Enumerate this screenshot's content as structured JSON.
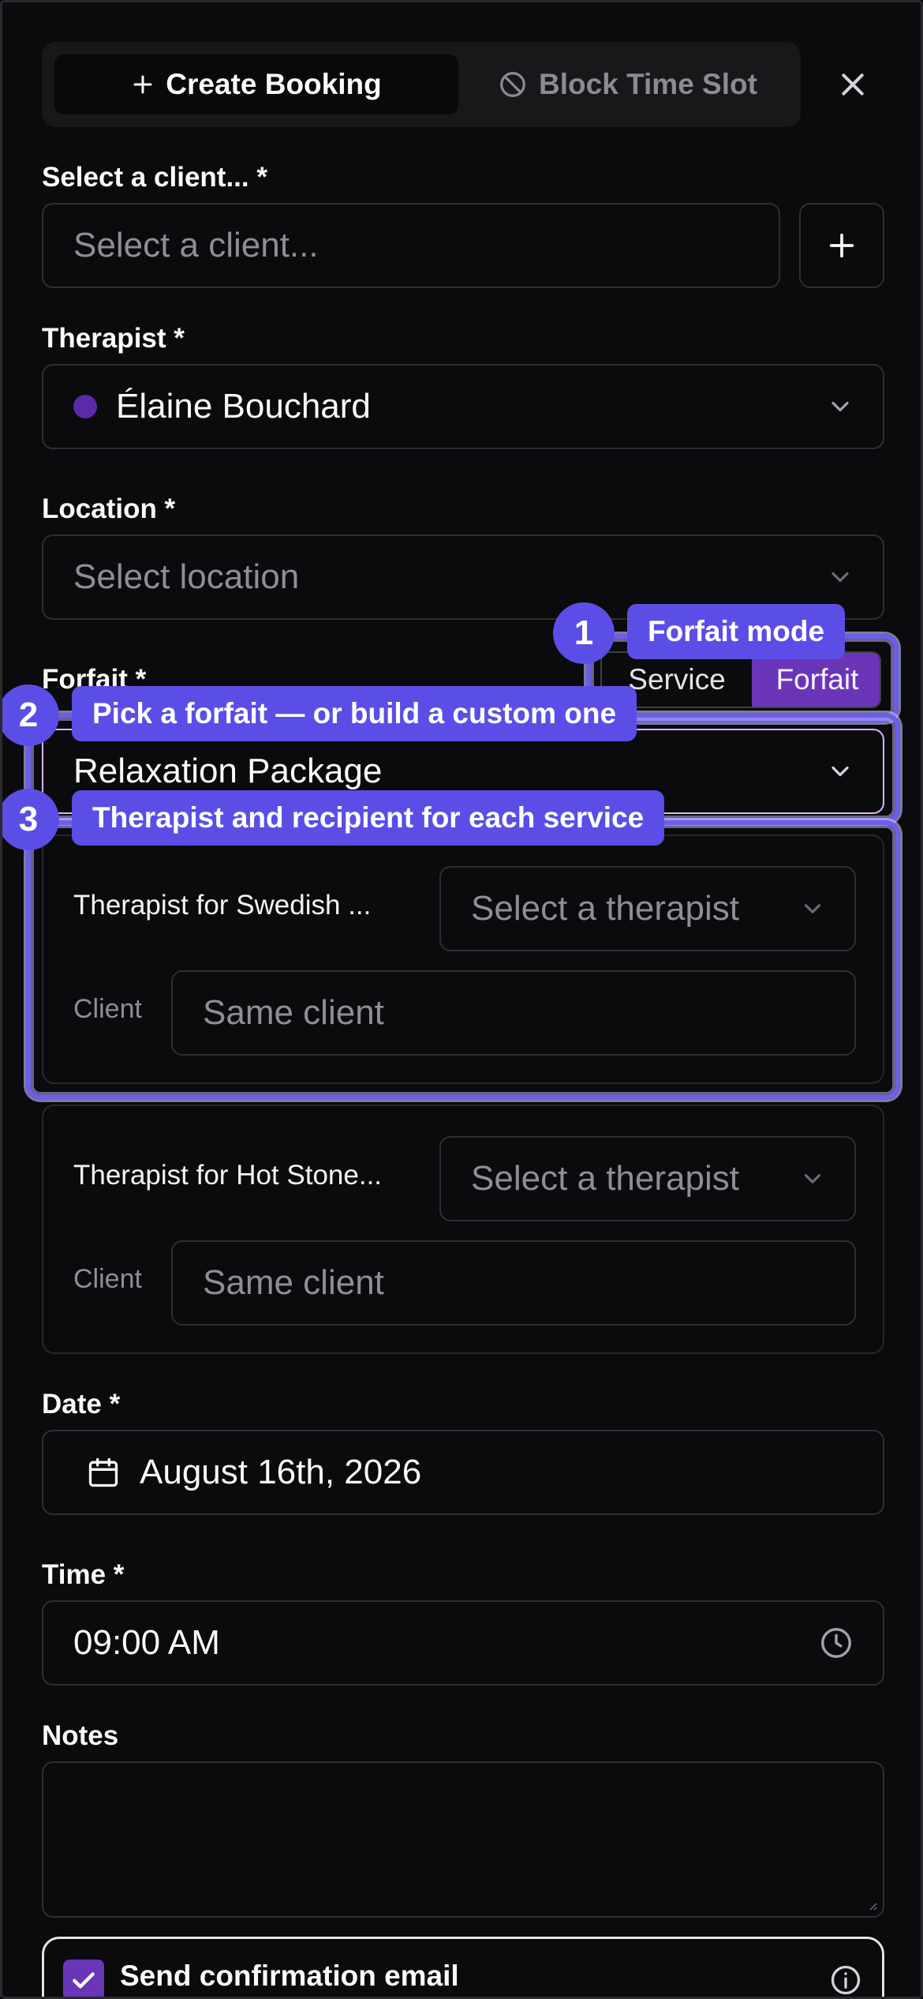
{
  "tabs": {
    "create_booking": "Create Booking",
    "block_time_slot": "Block Time Slot"
  },
  "client": {
    "label": "Select a client... *",
    "placeholder": "Select a client..."
  },
  "therapist": {
    "label": "Therapist *",
    "value": "Élaine Bouchard",
    "dot_color": "#5b2aa8"
  },
  "location": {
    "label": "Location *",
    "placeholder": "Select location"
  },
  "forfait": {
    "label": "Forfait *",
    "mode_options": [
      "Service",
      "Forfait"
    ],
    "mode_selected": "Forfait",
    "value": "Relaxation Package"
  },
  "services": [
    {
      "therapist_label": "Therapist for Swedish ...",
      "therapist_placeholder": "Select a therapist",
      "client_label": "Client",
      "client_placeholder": "Same client"
    },
    {
      "therapist_label": "Therapist for Hot Stone...",
      "therapist_placeholder": "Select a therapist",
      "client_label": "Client",
      "client_placeholder": "Same client"
    }
  ],
  "date": {
    "label": "Date *",
    "value": "August 16th, 2026"
  },
  "time": {
    "label": "Time *",
    "value": "09:00 AM"
  },
  "notes": {
    "label": "Notes",
    "value": ""
  },
  "confirmation": {
    "label": "Send confirmation email",
    "checked": true
  },
  "tour": [
    {
      "number": "1",
      "text": "Forfait mode"
    },
    {
      "number": "2",
      "text": "Pick a forfait — or build a custom one"
    },
    {
      "number": "3",
      "text": "Therapist and recipient for each service"
    }
  ],
  "colors": {
    "accent": "#6b35b8",
    "tour": "#5b4ee6",
    "background": "#09090b"
  }
}
